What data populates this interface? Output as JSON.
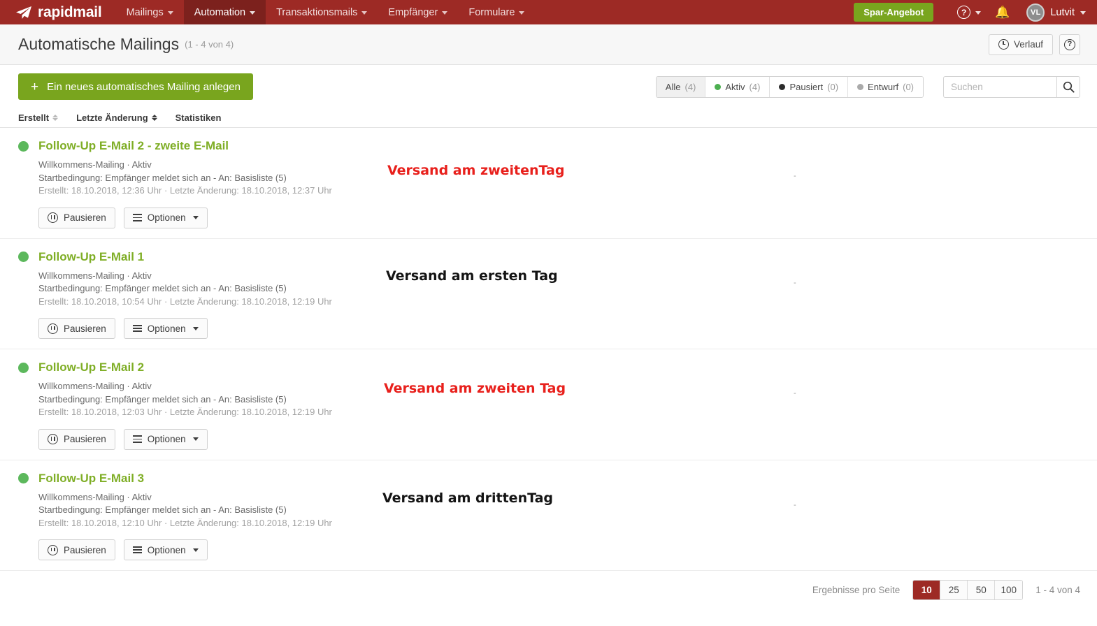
{
  "brand": {
    "name": "rapidmail",
    "logo_icon": "paper-plane-icon"
  },
  "nav": {
    "items": [
      {
        "label": "Mailings",
        "active": false,
        "caret": true
      },
      {
        "label": "Automation",
        "active": true,
        "caret": true
      },
      {
        "label": "Transaktionsmails",
        "active": false,
        "caret": true
      },
      {
        "label": "Empfänger",
        "active": false,
        "caret": true
      },
      {
        "label": "Formulare",
        "active": false,
        "caret": true
      }
    ],
    "promo_button": "Spar-Angebot",
    "help_icon": "question-circle-icon",
    "notifications_icon": "bell-icon",
    "user": {
      "initials": "VL",
      "name": "Lutvit"
    }
  },
  "header": {
    "title": "Automatische Mailings",
    "count": "(1 - 4 von 4)",
    "history_button": "Verlauf",
    "history_icon": "clock-icon",
    "help_button_icon": "question-circle-icon"
  },
  "toolbar": {
    "create_button": "Ein neues automatisches Mailing anlegen",
    "create_icon": "plus-icon",
    "filters": [
      {
        "label": "Alle",
        "count": "(4)",
        "dot": "none",
        "selected": true
      },
      {
        "label": "Aktiv",
        "count": "(4)",
        "dot": "green",
        "selected": false
      },
      {
        "label": "Pausiert",
        "count": "(0)",
        "dot": "black",
        "selected": false
      },
      {
        "label": "Entwurf",
        "count": "(0)",
        "dot": "gray",
        "selected": false
      }
    ],
    "search_placeholder": "Suchen",
    "search_value": "",
    "search_icon": "search-icon"
  },
  "table": {
    "columns": {
      "created": "Erstellt",
      "last_change": "Letzte Änderung",
      "statistics": "Statistiken"
    },
    "rows": [
      {
        "status": "active",
        "title": "Follow-Up E-Mail 2 - zweite E-Mail",
        "type_line": "Willkommens-Mailing · Aktiv",
        "condition_line": "Startbedingung: Empfänger meldet sich an - An: Basisliste (5)",
        "dates_line": "Erstellt: 18.10.2018, 12:36 Uhr · Letzte Änderung: 18.10.2018, 12:37 Uhr",
        "pause_button": "Pausieren",
        "options_button": "Optionen",
        "annotation": "Versand am zweitenTag",
        "annotation_color": "red",
        "statistics": "-"
      },
      {
        "status": "active",
        "title": "Follow-Up E-Mail 1",
        "type_line": "Willkommens-Mailing · Aktiv",
        "condition_line": "Startbedingung: Empfänger meldet sich an - An: Basisliste (5)",
        "dates_line": "Erstellt: 18.10.2018, 10:54 Uhr · Letzte Änderung: 18.10.2018, 12:19 Uhr",
        "pause_button": "Pausieren",
        "options_button": "Optionen",
        "annotation": "Versand am ersten Tag",
        "annotation_color": "black",
        "statistics": "-"
      },
      {
        "status": "active",
        "title": "Follow-Up E-Mail 2",
        "type_line": "Willkommens-Mailing · Aktiv",
        "condition_line": "Startbedingung: Empfänger meldet sich an - An: Basisliste (5)",
        "dates_line": "Erstellt: 18.10.2018, 12:03 Uhr · Letzte Änderung: 18.10.2018, 12:19 Uhr",
        "pause_button": "Pausieren",
        "options_button": "Optionen",
        "annotation": "Versand am zweiten Tag",
        "annotation_color": "red",
        "statistics": "-"
      },
      {
        "status": "active",
        "title": "Follow-Up E-Mail 3",
        "type_line": "Willkommens-Mailing · Aktiv",
        "condition_line": "Startbedingung: Empfänger meldet sich an - An: Basisliste (5)",
        "dates_line": "Erstellt: 18.10.2018, 12:10 Uhr · Letzte Änderung: 18.10.2018, 12:19 Uhr",
        "pause_button": "Pausieren",
        "options_button": "Optionen",
        "annotation": "Versand am drittenTag",
        "annotation_color": "black",
        "statistics": "-"
      }
    ]
  },
  "footer": {
    "per_page_label": "Ergebnisse pro Seite",
    "per_page_options": [
      "10",
      "25",
      "50",
      "100"
    ],
    "per_page_selected": "10",
    "range": "1 - 4 von 4"
  },
  "colors": {
    "brand_red": "#9d2a25",
    "accent_green": "#79a51e",
    "title_green": "#7fae26",
    "status_green": "#5cb85c",
    "annotation_red": "#e8201c"
  }
}
